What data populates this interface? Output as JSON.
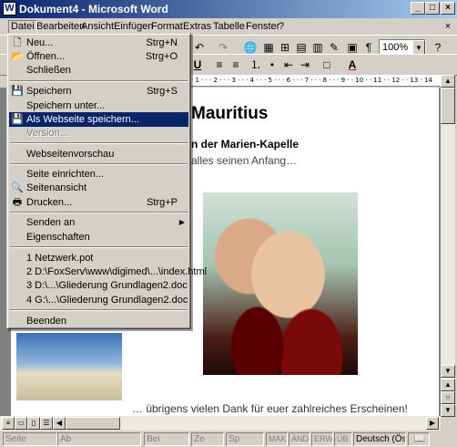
{
  "window": {
    "title": "Dokument4 - Microsoft Word",
    "app_icon": "W"
  },
  "window_buttons": {
    "minimize": "_",
    "maximize": "□",
    "close": "×"
  },
  "menubar": {
    "items": [
      "Datei",
      "Bearbeiten",
      "Ansicht",
      "Einfügen",
      "Format",
      "Extras",
      "Tabelle",
      "Fenster",
      "?"
    ],
    "doc_close": "×"
  },
  "toolbar": {
    "zoom": "100%",
    "font_color_letter": "A",
    "undo_symbol": "↶",
    "redo_symbol": "↷"
  },
  "ruler": {
    "ticks": "· 1 · · · 2 · · · 3 · · · 4 · · · 5 · · · 6 · · · 7 · · · 8 · · · 9 · · 10 · · 11 · · 12 · · 13 · 14"
  },
  "document": {
    "heading": "Mauritius",
    "line1": "n der Marien-Kapelle",
    "line2": "alles seinen Anfang…",
    "bottom_line": "… übrigens vielen Dank für euer zahlreiches Erscheinen!"
  },
  "file_menu": {
    "items": [
      {
        "label": "Neu...",
        "shortcut": "Strg+N",
        "icon": "new-doc-icon",
        "glyph": "🗋"
      },
      {
        "label": "Öffnen...",
        "shortcut": "Strg+O",
        "icon": "open-folder-icon",
        "glyph": "📂"
      },
      {
        "label": "Schließen",
        "shortcut": "",
        "icon": "",
        "glyph": ""
      },
      {
        "label": "Speichern",
        "shortcut": "Strg+S",
        "icon": "save-icon",
        "glyph": "💾"
      },
      {
        "label": "Speichern unter...",
        "shortcut": "",
        "icon": "",
        "glyph": ""
      },
      {
        "label": "Als Webseite speichern...",
        "shortcut": "",
        "icon": "save-web-icon",
        "glyph": "💾"
      },
      {
        "label": "Version...",
        "shortcut": "",
        "icon": "",
        "glyph": ""
      },
      {
        "label": "Webseitenvorschau",
        "shortcut": "",
        "icon": "",
        "glyph": ""
      },
      {
        "label": "Seite einrichten...",
        "shortcut": "",
        "icon": "",
        "glyph": ""
      },
      {
        "label": "Seitenansicht",
        "shortcut": "",
        "icon": "print-preview-icon",
        "glyph": "🔍"
      },
      {
        "label": "Drucken...",
        "shortcut": "Strg+P",
        "icon": "print-icon",
        "glyph": "🖶"
      },
      {
        "label": "Senden an",
        "shortcut": "",
        "icon": "",
        "glyph": ""
      },
      {
        "label": "Eigenschaften",
        "shortcut": "",
        "icon": "",
        "glyph": ""
      },
      {
        "label": "1 Netzwerk.pot",
        "shortcut": "",
        "icon": "",
        "glyph": ""
      },
      {
        "label": "2 D:\\FoxServ\\www\\digimed\\...\\index.html",
        "shortcut": "",
        "icon": "",
        "glyph": ""
      },
      {
        "label": "3 D:\\...\\Gliederung Grundlagen2.doc",
        "shortcut": "",
        "icon": "",
        "glyph": ""
      },
      {
        "label": "4 G:\\...\\Gliederung Grundlagen2.doc",
        "shortcut": "",
        "icon": "",
        "glyph": ""
      },
      {
        "label": "Beenden",
        "shortcut": "",
        "icon": "",
        "glyph": ""
      }
    ],
    "submenu_arrow": "▶"
  },
  "statusbar": {
    "cells": [
      "Seite",
      "Ab",
      "Bei",
      "Ze",
      "Sp",
      "MAK",
      "ÄND",
      "ERW",
      "ÜB",
      "Deutsch (Ös"
    ]
  },
  "colors": {
    "highlight": "#0a246a",
    "face": "#d4d0c8",
    "font_color_red": "#ff0000"
  }
}
